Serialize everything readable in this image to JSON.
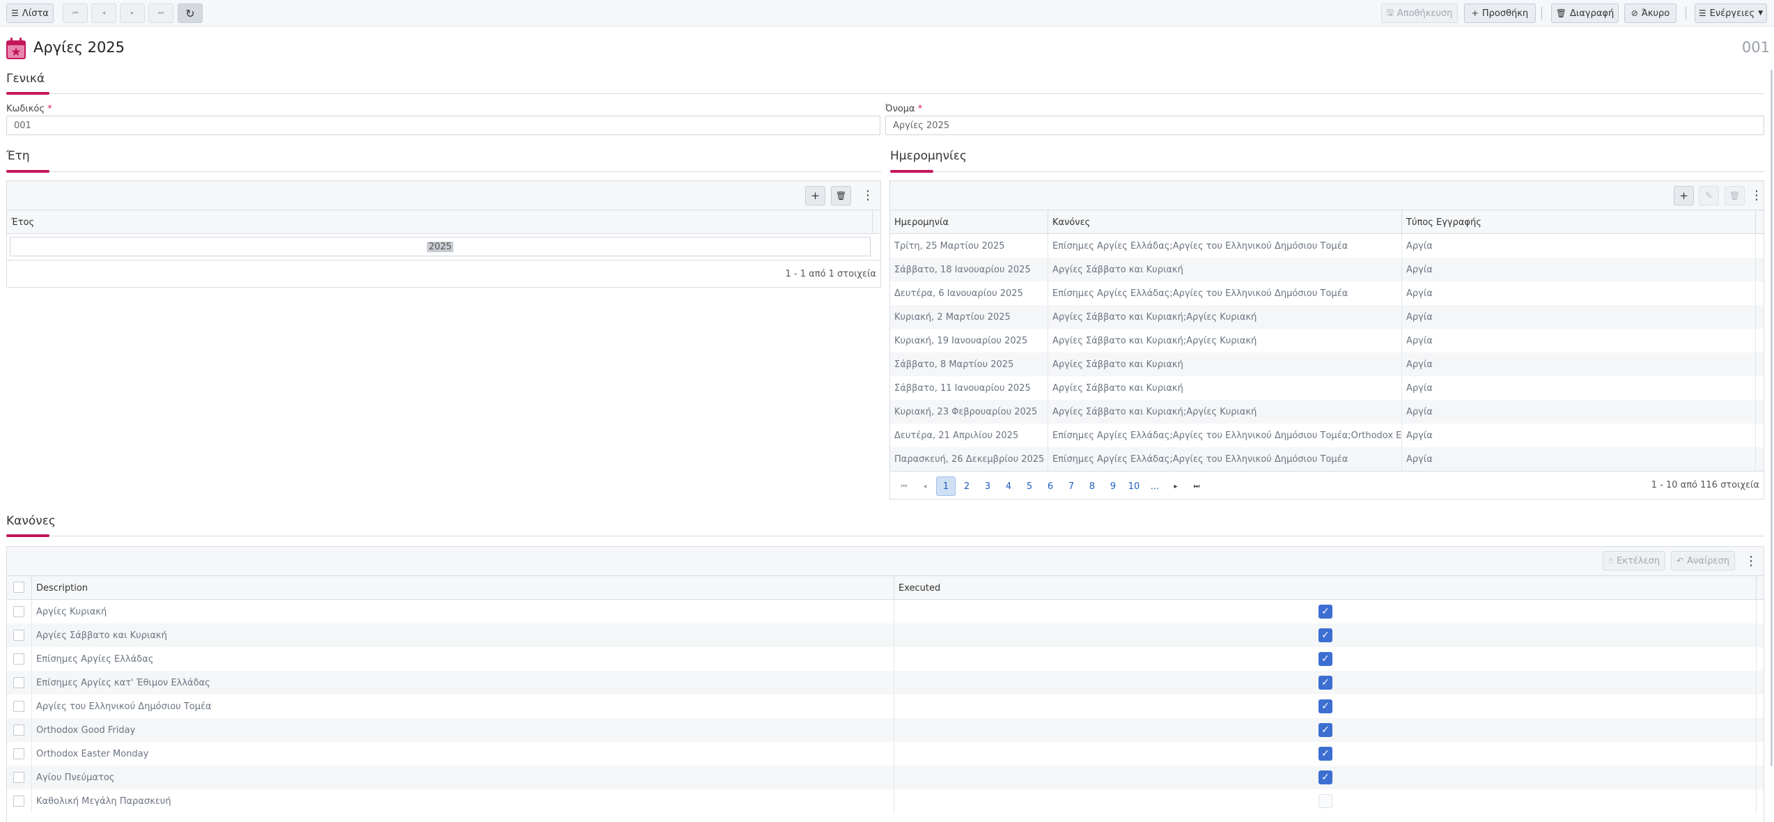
{
  "toolbar": {
    "list_label": "Λίστα",
    "save_label": "Αποθήκευση",
    "add_label": "Προσθήκη",
    "delete_label": "Διαγραφή",
    "cancel_label": "Άκυρο",
    "actions_label": "Ενέργειες"
  },
  "header": {
    "title": "Αργίες 2025",
    "code": "001"
  },
  "sections": {
    "general": "Γενικά",
    "years": "Έτη",
    "dates": "Ημερομηνίες",
    "rules": "Κανόνες"
  },
  "form": {
    "code_label": "Κωδικός",
    "code_value": "001",
    "name_label": "Όνομα",
    "name_value": "Αργίες 2025",
    "required_mark": "*"
  },
  "years_grid": {
    "column": "Έτος",
    "rows": [
      "2025"
    ],
    "footer": "1 - 1 από 1 στοιχεία"
  },
  "dates_grid": {
    "columns": [
      "Ημερομηνία",
      "Κανόνες",
      "Τύπος Εγγραφής"
    ],
    "rows": [
      [
        "Τρίτη, 25 Μαρτίου 2025",
        "Επίσημες Αργίες Ελλάδας;Αργίες του Ελληνικού Δημόσιου Τομέα",
        "Αργία"
      ],
      [
        "Σάββατο, 18 Ιανουαρίου 2025",
        "Αργίες Σάββατο και Κυριακή",
        "Αργία"
      ],
      [
        "Δευτέρα, 6 Ιανουαρίου 2025",
        "Επίσημες Αργίες Ελλάδας;Αργίες του Ελληνικού Δημόσιου Τομέα",
        "Αργία"
      ],
      [
        "Κυριακή, 2 Μαρτίου 2025",
        "Αργίες Σάββατο και Κυριακή;Αργίες Κυριακή",
        "Αργία"
      ],
      [
        "Κυριακή, 19 Ιανουαρίου 2025",
        "Αργίες Σάββατο και Κυριακή;Αργίες Κυριακή",
        "Αργία"
      ],
      [
        "Σάββατο, 8 Μαρτίου 2025",
        "Αργίες Σάββατο και Κυριακή",
        "Αργία"
      ],
      [
        "Σάββατο, 11 Ιανουαρίου 2025",
        "Αργίες Σάββατο και Κυριακή",
        "Αργία"
      ],
      [
        "Κυριακή, 23 Φεβρουαρίου 2025",
        "Αργίες Σάββατο και Κυριακή;Αργίες Κυριακή",
        "Αργία"
      ],
      [
        "Δευτέρα, 21 Απριλίου 2025",
        "Επίσημες Αργίες Ελλάδας;Αργίες του Ελληνικού Δημόσιου Τομέα;Orthodox Easter Mo",
        "Αργία"
      ],
      [
        "Παρασκευή, 26 Δεκεμβρίου 2025",
        "Επίσημες Αργίες Ελλάδας;Αργίες του Ελληνικού Δημόσιου Τομέα",
        "Αργία"
      ]
    ],
    "pages": [
      "1",
      "2",
      "3",
      "4",
      "5",
      "6",
      "7",
      "8",
      "9",
      "10",
      "..."
    ],
    "current_page": "1",
    "footer": "1 - 10 από 116 στοιχεία"
  },
  "rules_grid": {
    "execute_label": "Εκτέλεση",
    "undo_label": "Αναίρεση",
    "columns": [
      "Description",
      "Executed"
    ],
    "rows": [
      {
        "description": "Αργίες Κυριακή",
        "executed": true
      },
      {
        "description": "Αργίες Σάββατο και Κυριακή",
        "executed": true
      },
      {
        "description": "Επίσημες Αργίες Ελλάδας",
        "executed": true
      },
      {
        "description": "Επίσημες Αργίες κατ' Έθιμον Ελλάδας",
        "executed": true
      },
      {
        "description": "Αργίες του Ελληνικού Δημόσιου Τομέα",
        "executed": true
      },
      {
        "description": "Orthodox Good Friday",
        "executed": true
      },
      {
        "description": "Orthodox Easter Monday",
        "executed": true
      },
      {
        "description": "Αγίου Πνεύματος",
        "executed": true
      },
      {
        "description": "Καθολική Μεγάλη Παρασκευή",
        "executed": false
      }
    ]
  },
  "colors": {
    "accent": "#c2185b",
    "checkbox": "#3c6fd1",
    "link": "#1f5fbf"
  }
}
